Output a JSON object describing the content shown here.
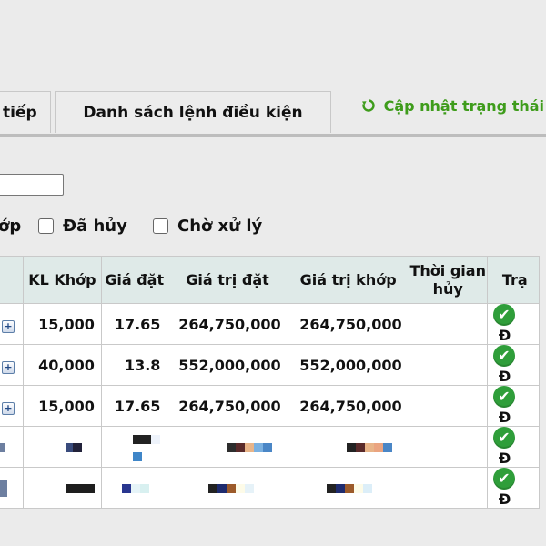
{
  "tabs": [
    {
      "label": "tiếp"
    },
    {
      "label": "Danh sách lệnh điều kiện"
    }
  ],
  "refresh": {
    "label": "Cập nhật trạng thái l"
  },
  "search": {
    "value": ""
  },
  "filters": [
    {
      "label": "ớp",
      "checked": false
    },
    {
      "label": "Đã hủy",
      "checked": false
    },
    {
      "label": "Chờ xử lý",
      "checked": false
    }
  ],
  "table": {
    "headers": [
      "",
      "KL Khớp",
      "Giá đặt",
      "Giá trị đặt",
      "Giá trị khớp",
      "Thời gian\nhủy",
      "Trạ"
    ],
    "rows": [
      {
        "kl_khop": "15,000",
        "gia_dat": "17.65",
        "gia_tri_dat": "264,750,000",
        "gia_tri_khop": "264,750,000",
        "thoi_gian_huy": "",
        "status": "Đ"
      },
      {
        "kl_khop": "40,000",
        "gia_dat": "13.8",
        "gia_tri_dat": "552,000,000",
        "gia_tri_khop": "552,000,000",
        "thoi_gian_huy": "",
        "status": "Đ"
      },
      {
        "kl_khop": "15,000",
        "gia_dat": "17.65",
        "gia_tri_dat": "264,750,000",
        "gia_tri_khop": "264,750,000",
        "thoi_gian_huy": "",
        "status": "Đ"
      },
      {
        "kl_khop": "",
        "gia_dat": "",
        "gia_tri_dat": "",
        "gia_tri_khop": "",
        "thoi_gian_huy": "",
        "status": "Đ"
      },
      {
        "kl_khop": "",
        "gia_dat": "",
        "gia_tri_dat": "",
        "gia_tri_khop": "",
        "thoi_gian_huy": "",
        "status": "Đ"
      }
    ]
  },
  "colors": {
    "accent_green": "#3e9c1b",
    "header_bg": "#dfeae8",
    "check_green": "#2f9e3a"
  },
  "icons": {
    "refresh": "refresh-icon",
    "expand": "plus-icon",
    "status": "check-circle-icon"
  }
}
